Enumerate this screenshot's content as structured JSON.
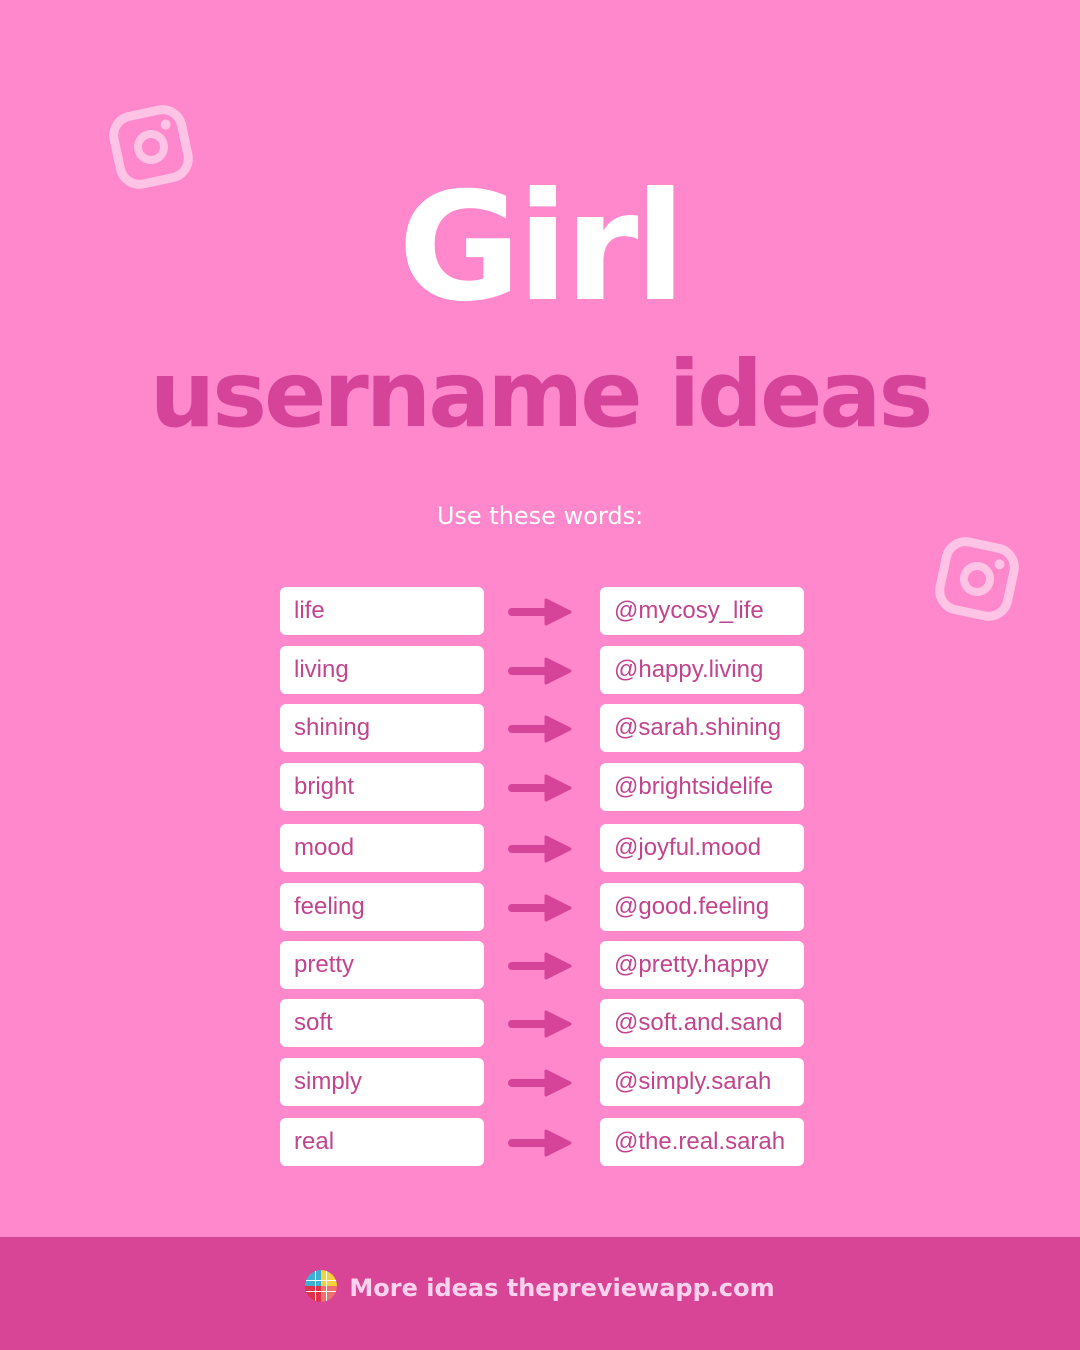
{
  "colors": {
    "background": "#ff87cc",
    "accent": "#d6449a",
    "footer": "#d84496",
    "text_pink": "#c2448e",
    "white": "#ffffff"
  },
  "icons": {
    "decor": "instagram-icon",
    "arrow": "arrow-right-icon",
    "logo": "preview-app-logo"
  },
  "header": {
    "title": "Girl",
    "subtitle": "username ideas"
  },
  "intro": "Use these words:",
  "rows": [
    {
      "word": "life",
      "handle": "@mycosy_life"
    },
    {
      "word": "living",
      "handle": "@happy.living"
    },
    {
      "word": "shining",
      "handle": "@sarah.shining"
    },
    {
      "word": "bright",
      "handle": "@brightsidelife"
    },
    {
      "word": "mood",
      "handle": "@joyful.mood"
    },
    {
      "word": "feeling",
      "handle": "@good.feeling"
    },
    {
      "word": "pretty",
      "handle": "@pretty.happy"
    },
    {
      "word": "soft",
      "handle": "@soft.and.sand"
    },
    {
      "word": "simply",
      "handle": "@simply.sarah"
    },
    {
      "word": "real",
      "handle": "@the.real.sarah"
    }
  ],
  "footer": {
    "text": "More ideas thepreviewapp.com"
  }
}
